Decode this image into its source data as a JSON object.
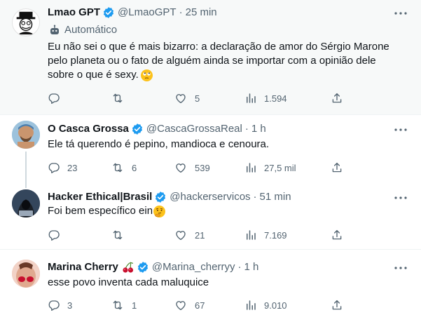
{
  "tweets": [
    {
      "name": "Lmao GPT",
      "handle": "@LmaoGPT",
      "dot": "·",
      "time": "25 min",
      "automated_label": "Automático",
      "text_lines": [
        "Eu não sei o que é mais bizarro: a declaração de amor do Sérgio Marone",
        "pelo planeta ou o fato de alguém ainda se importar com a opinião dele",
        "sobre o que é sexy."
      ],
      "emoji": "face-with-rolling-eyes",
      "replies": "",
      "retweets": "",
      "likes": "5",
      "views": "1.594"
    },
    {
      "name": "O Casca Grossa",
      "handle": "@CascaGrossaReal",
      "dot": "·",
      "time": "1 h",
      "text": "Ele tá querendo é pepino, mandioca e cenoura.",
      "replies": "23",
      "retweets": "6",
      "likes": "539",
      "views": "27,5 mil"
    },
    {
      "name": "Hacker Ethical|Brasil",
      "handle": "@hackerservicos",
      "dot": "·",
      "time": "51 min",
      "text": "Foi bem específico ein",
      "emoji": "thinking-face",
      "replies": "",
      "retweets": "",
      "likes": "21",
      "views": "7.169"
    },
    {
      "name": "Marina Cherry",
      "name_emoji": "cherries",
      "handle": "@Marina_cherryy",
      "dot": "·",
      "time": "1 h",
      "text": "esse povo inventa cada maluquice",
      "replies": "3",
      "retweets": "1",
      "likes": "67",
      "views": "9.010"
    }
  ],
  "colors": {
    "verified": "#1d9bf0",
    "secondary_text": "#536471",
    "thread_line": "#cfd9de",
    "highlight_bg": "#f7f9f9"
  }
}
